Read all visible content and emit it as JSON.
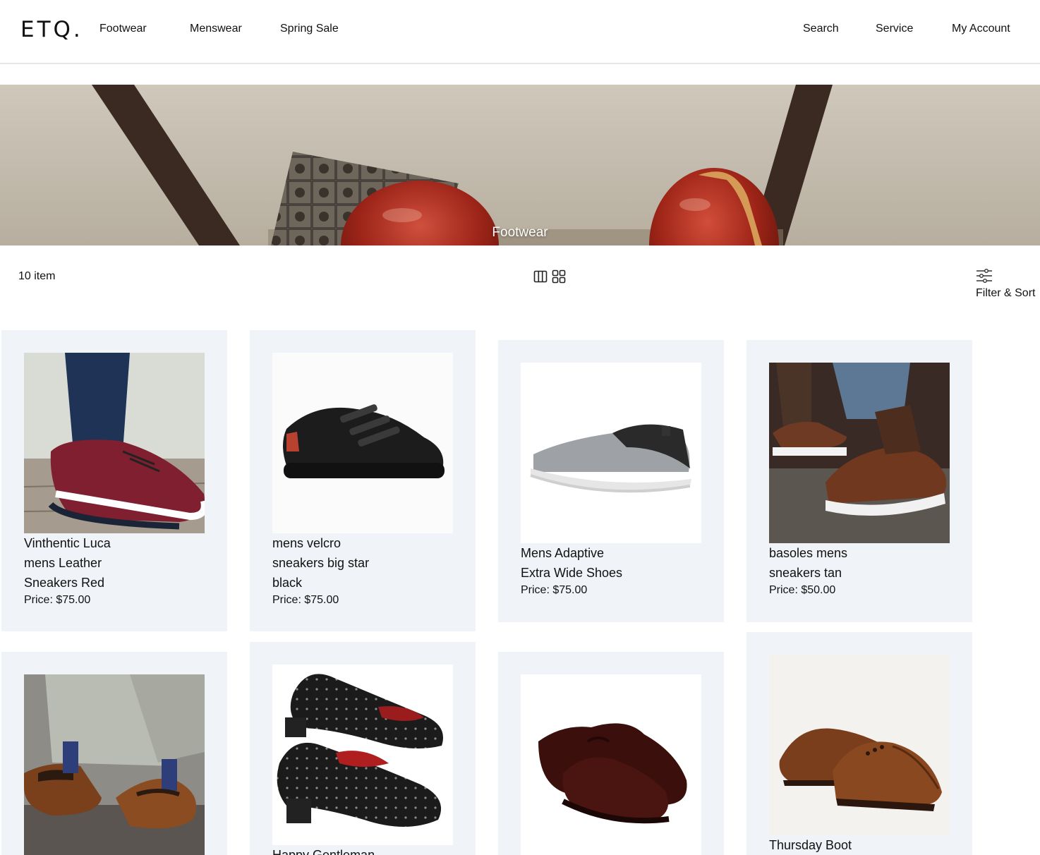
{
  "brand": {
    "logo": "ETQ."
  },
  "nav": {
    "left": [
      "Footwear",
      "Menswear",
      "Spring Sale"
    ],
    "right": [
      "Search",
      "Service",
      "My Account"
    ]
  },
  "hero": {
    "title": "Footwear"
  },
  "toolbar": {
    "item_count": "10 item",
    "filter_sort": "Filter & Sort",
    "view_options": [
      "three-column-grid-icon",
      "two-by-two-grid-icon"
    ]
  },
  "products": [
    {
      "name": "Vinthentic Luca mens Leather Sneakers Red",
      "price": "Price: $75.00"
    },
    {
      "name": "mens velcro sneakers big star black",
      "price": "Price: $75.00"
    },
    {
      "name": "Mens Adaptive Extra Wide Shoes",
      "price": "Price: $75.00"
    },
    {
      "name": "basoles mens sneakers tan",
      "price": "Price: $50.00"
    },
    {
      "name": "",
      "price": ""
    },
    {
      "name": "Happy Gentleman",
      "price": ""
    },
    {
      "name": "",
      "price": ""
    },
    {
      "name": "Thursday Boot",
      "price": ""
    }
  ],
  "colors": {
    "card_background": "#f0f4f8",
    "header_border": "#e5e7eb",
    "text": "#111111"
  }
}
